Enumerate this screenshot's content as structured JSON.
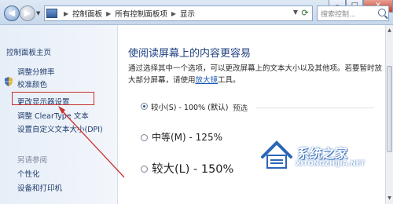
{
  "window": {
    "minimize_icon": "minimize-icon",
    "maximize_icon": "maximize-icon",
    "close_icon": "close-icon"
  },
  "address": {
    "crumbs": [
      "控制面板",
      "所有控制面板项",
      "显示"
    ]
  },
  "search": {
    "placeholder": "搜索控制..."
  },
  "sidebar": {
    "home": "控制面板主页",
    "items": [
      "调整分辨率",
      "校准颜色",
      "更改显示器设置",
      "调整 ClearType 文本",
      "设置自定义文本大小(DPI)"
    ],
    "see_also_heading": "另请参阅",
    "see_also": [
      "个性化",
      "设备和打印机"
    ]
  },
  "main": {
    "heading": "使阅读屏幕上的内容更容易",
    "desc_before": "通过选择其中一个选项，可以更改屏幕上的文本大小以及其他项。若要暂时放大部分屏幕，请使用",
    "desc_link": "放大镜",
    "desc_after": "工具。",
    "preview_label": "预选",
    "options": [
      {
        "label": "较小(S) - 100% (默认)",
        "selected": true
      },
      {
        "label": "中等(M) - 125%",
        "selected": false
      },
      {
        "label": "较大(L) - 150%",
        "selected": false
      }
    ]
  },
  "annotation": {
    "highlight_color": "#c9302c"
  },
  "watermark": {
    "text_cn": "系统之家",
    "text_en": "XITONGZHIJIA.NET",
    "color": "#2a66b8"
  }
}
